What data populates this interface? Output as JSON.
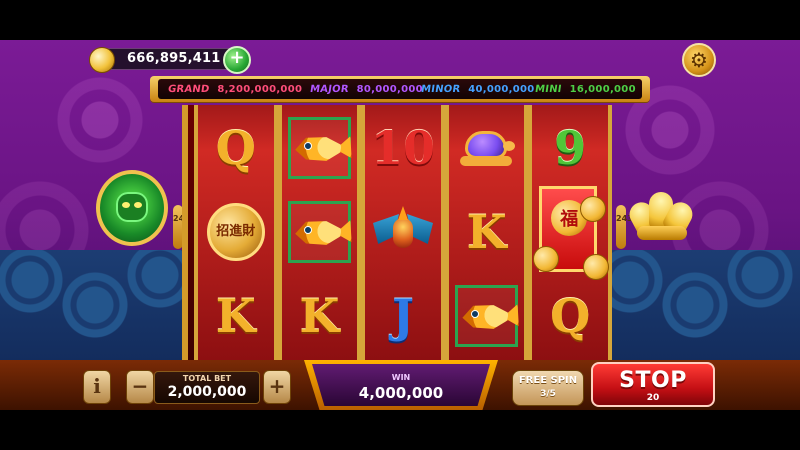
{
  "balance": {
    "amount": "666,895,411"
  },
  "jackpots": [
    {
      "label": "GRAND",
      "value": "8,200,000,000",
      "color": "#ff4e7a"
    },
    {
      "label": "MAJOR",
      "value": "80,000,000",
      "color": "#b157ff"
    },
    {
      "label": "MINOR",
      "value": "40,000,000",
      "color": "#45a2ff"
    },
    {
      "label": "MINI",
      "value": "16,000,000",
      "color": "#4ed046"
    }
  ],
  "reels": [
    [
      "Q",
      "招進財",
      "K"
    ],
    [
      "fish",
      "fish",
      "K"
    ],
    [
      "10",
      "phoenix",
      "J"
    ],
    [
      "turtle",
      "K",
      "fish"
    ],
    [
      "9",
      "envelope",
      "Q"
    ]
  ],
  "side_tabs": {
    "left": "243",
    "right": "243"
  },
  "icons": {
    "settings": "gear-icon",
    "coin": "coin-icon",
    "add": "plus-icon"
  },
  "controls": {
    "info_label": "i",
    "minus_label": "−",
    "plus_label": "+",
    "total_bet_label": "TOTAL BET",
    "total_bet_value": "2,000,000",
    "win_label": "WIN",
    "win_value": "4,000,000",
    "free_spin_label": "FREE SPIN",
    "free_spin_count": "3/5",
    "stop_label": "STOP",
    "stop_count": "20"
  },
  "symbols": {
    "envelope_text": "福"
  }
}
